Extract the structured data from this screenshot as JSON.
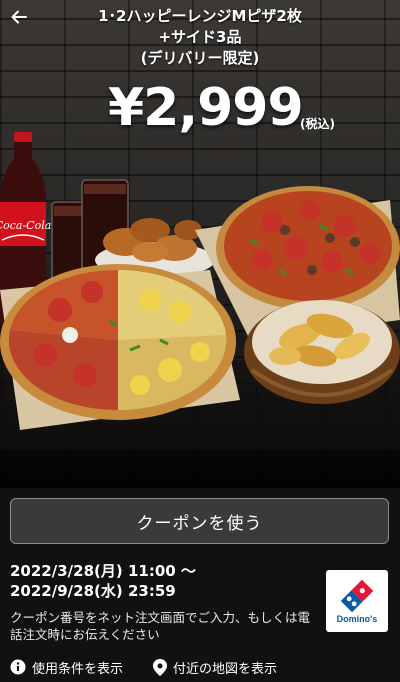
{
  "header": {
    "back_icon": "arrow-left-icon",
    "title_line1": "1･2ハッピーレンジMピザ2枚",
    "title_line2": "+サイド3品",
    "title_line3": "(デリバリー限定)"
  },
  "price": {
    "amount": "¥2,999",
    "tax_note": "(税込)"
  },
  "food_image": {
    "bottle_label": "Coca-Cola"
  },
  "coupon": {
    "use_button_label": "クーポンを使う",
    "date_range_line1": "2022/3/28(月) 11:00 〜",
    "date_range_line2": "2022/9/28(水) 23:59",
    "instruction": "クーポン番号をネット注文画面でご入力、もしくは電話注文時にお伝えください",
    "logo_text": "Domino's"
  },
  "footer_links": {
    "terms_icon": "info-icon",
    "terms_label": "使用条件を表示",
    "map_icon": "location-pin-icon",
    "map_label": "付近の地図を表示"
  },
  "colors": {
    "background": "#000000",
    "button_bg": "#3a3a3a",
    "button_border": "#8d8d8d",
    "domino_blue": "#0b5aa6",
    "domino_red": "#e31837",
    "coke_red": "#d1121c"
  }
}
